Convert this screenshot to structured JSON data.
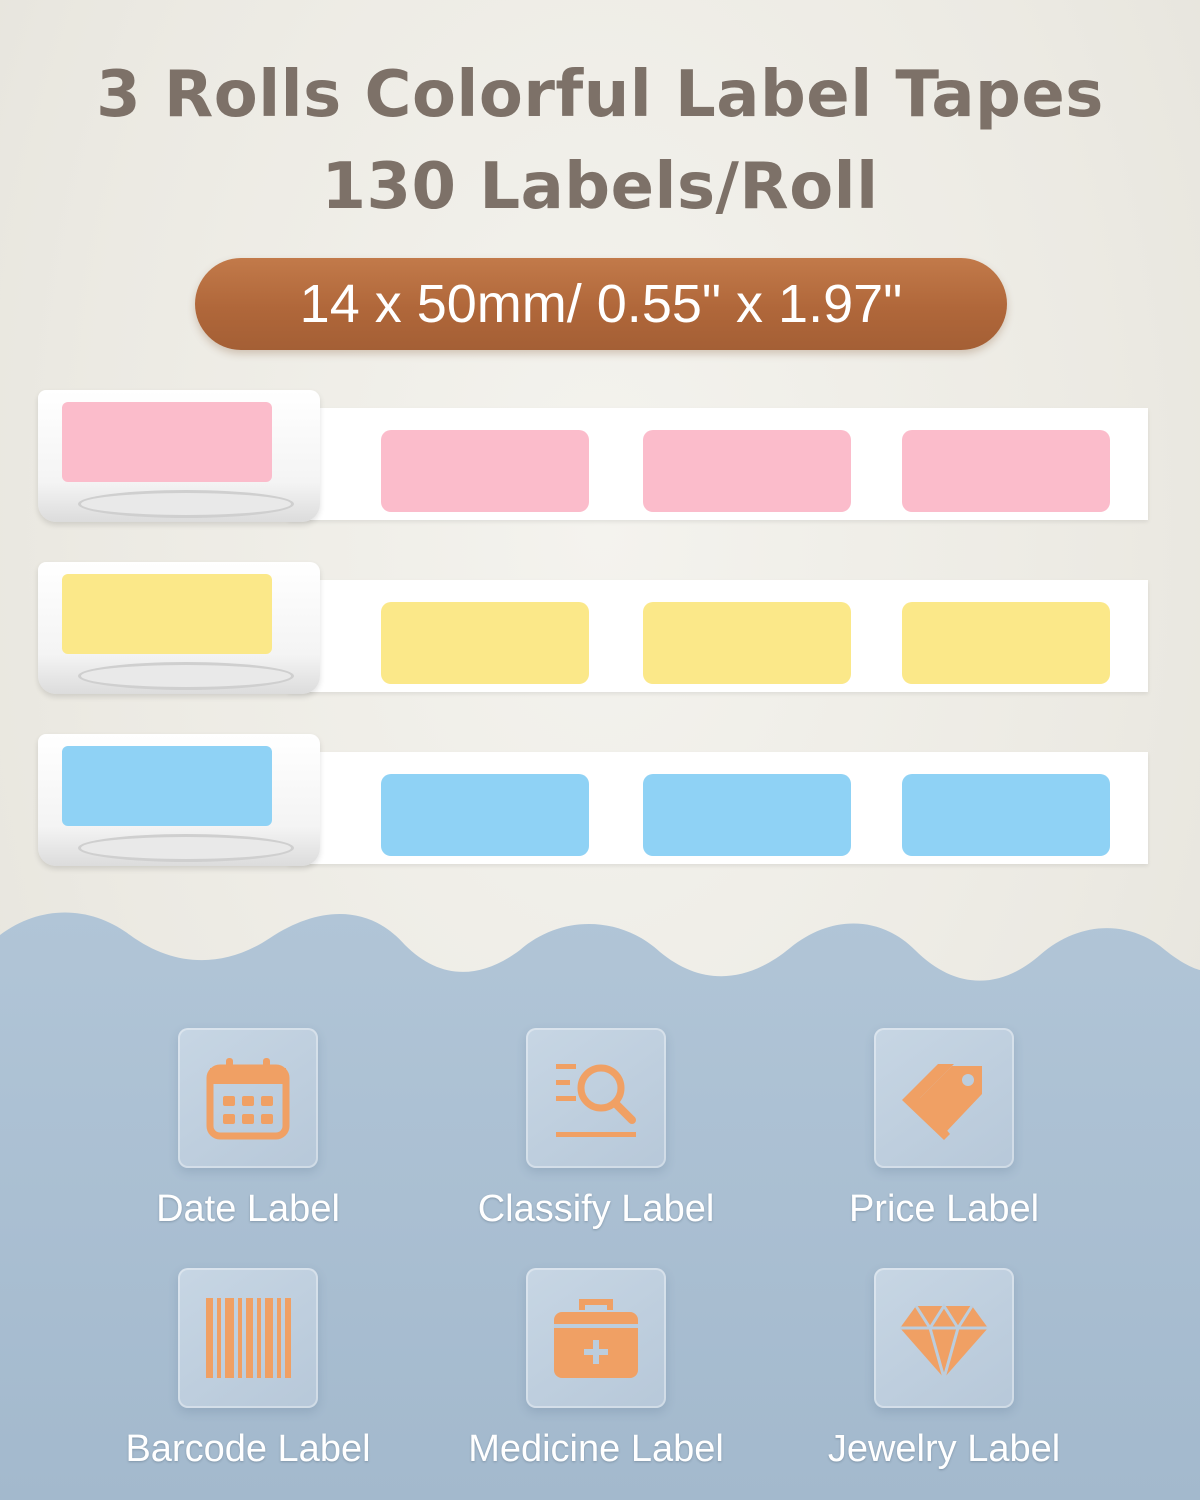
{
  "headline": {
    "line1": "3 Rolls Colorful Label Tapes",
    "line2": "130 Labels/Roll"
  },
  "size_badge": "14 x 50mm/ 0.55\" x 1.97\"",
  "colors": {
    "title": "#7d7168",
    "badge": "#b0673a",
    "bottom_panel": "#a9bfd2",
    "icon": "#f0a064",
    "pink_label": "#fbbccb",
    "yellow_label": "#fbe889",
    "blue_label": "#8fd2f5"
  },
  "rolls": [
    {
      "color_name": "pink",
      "label_color": "#fbbccb",
      "visible_labels": 3
    },
    {
      "color_name": "yellow",
      "label_color": "#fbe889",
      "visible_labels": 3
    },
    {
      "color_name": "blue",
      "label_color": "#8fd2f5",
      "visible_labels": 3
    }
  ],
  "uses": [
    {
      "icon": "calendar-icon",
      "label": "Date Label"
    },
    {
      "icon": "search-list-icon",
      "label": "Classify Label"
    },
    {
      "icon": "price-tag-icon",
      "label": "Price Label"
    },
    {
      "icon": "barcode-icon",
      "label": "Barcode Label"
    },
    {
      "icon": "medicine-kit-icon",
      "label": "Medicine Label"
    },
    {
      "icon": "diamond-icon",
      "label": "Jewelry Label"
    }
  ]
}
